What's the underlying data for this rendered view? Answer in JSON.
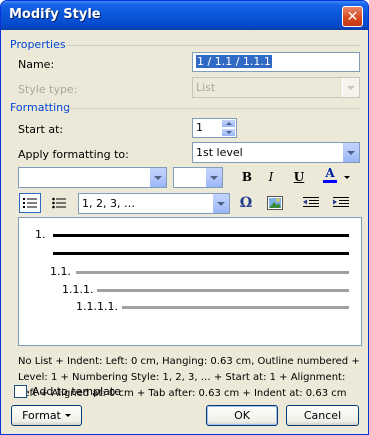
{
  "window": {
    "title": "Modify Style"
  },
  "properties": {
    "section_title": "Properties",
    "name_label": "Name:",
    "name_value": "1 / 1.1 / 1.1.1",
    "style_type_label": "Style type:",
    "style_type_value": "List"
  },
  "formatting": {
    "section_title": "Formatting",
    "start_at_label": "Start at:",
    "start_at_value": "1",
    "apply_label": "Apply formatting to:",
    "apply_value": "1st level",
    "font_name_value": "",
    "font_size_value": "",
    "bold_label": "B",
    "italic_label": "I",
    "underline_label": "U",
    "font_color_label": "A",
    "numbering_style_value": "1, 2, 3, …",
    "symbol_label": "Ω"
  },
  "preview": {
    "levels": [
      "1.",
      "1.1.",
      "1.1.1.",
      "1.1.1.1."
    ]
  },
  "description": "No List + Indent: Left: 0 cm, Hanging: 0.63 cm, Outline numbered + Level: 1 + Numbering Style: 1, 2, 3, … + Start at: 1 + Alignment: Left + Aligned at: 0 cm + Tab after: 0.63 cm + Indent at: 0.63 cm",
  "add_to_template_label": "Add to template",
  "buttons": {
    "format": "Format",
    "ok": "OK",
    "cancel": "Cancel"
  },
  "colors": {
    "title_bar": "#0a56d8",
    "section_title": "#0046d5",
    "font_color_bar": "#0000ff"
  }
}
